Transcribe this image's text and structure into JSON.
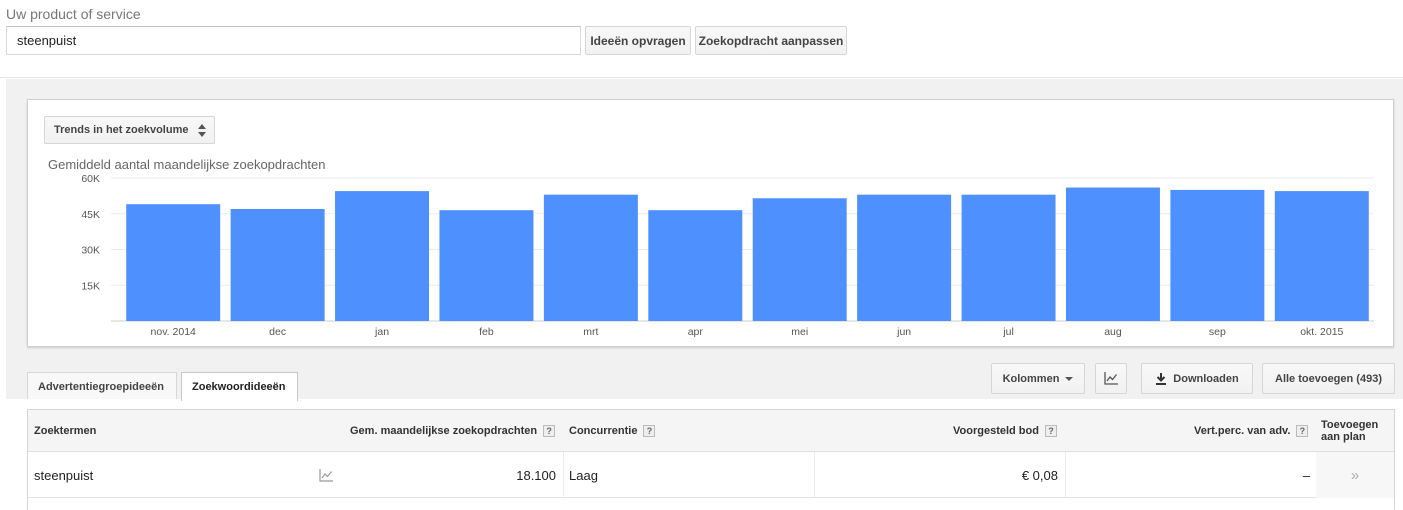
{
  "search": {
    "label": "Uw product of service",
    "value": "steenpuist",
    "ideas_button": "Ideeën opvragen",
    "modify_button": "Zoekopdracht aanpassen"
  },
  "chart_panel": {
    "select_label": "Trends in het zoekvolume",
    "title": "Gemiddeld aantal maandelijkse zoekopdrachten"
  },
  "chart_data": {
    "type": "bar",
    "categories": [
      "nov. 2014",
      "dec",
      "jan",
      "feb",
      "mrt",
      "apr",
      "mei",
      "jun",
      "jul",
      "aug",
      "sep",
      "okt. 2015"
    ],
    "values": [
      49000,
      47000,
      54500,
      46500,
      53000,
      46500,
      51500,
      53000,
      53000,
      56000,
      55000,
      54500
    ],
    "ytick_labels": [
      "60K",
      "45K",
      "30K",
      "15K"
    ],
    "ytick_values": [
      60000,
      45000,
      30000,
      15000
    ],
    "ylim": [
      0,
      60000
    ],
    "grid": true,
    "bar_color": "#4d90fe"
  },
  "tabs": [
    {
      "label": "Advertentiegroepideeën"
    },
    {
      "label": "Zoekwoordideeën"
    }
  ],
  "toolbar": {
    "columns_label": "Kolommen",
    "download_label": "Downloaden",
    "add_all_label": "Alle toevoegen (493)"
  },
  "table": {
    "headers": {
      "terms": "Zoektermen",
      "monthly": "Gem. maandelijkse zoekopdrachten",
      "competition": "Concurrentie",
      "bid": "Voorgesteld bod",
      "impression": "Vert.perc. van adv.",
      "add_line1": "Toevoegen",
      "add_line2": "aan plan"
    },
    "help_mark": "?",
    "rows": [
      {
        "term": "steenpuist",
        "monthly": "18.100",
        "competition": "Laag",
        "bid": "€ 0,08",
        "impression": "–",
        "add": "»"
      }
    ]
  }
}
